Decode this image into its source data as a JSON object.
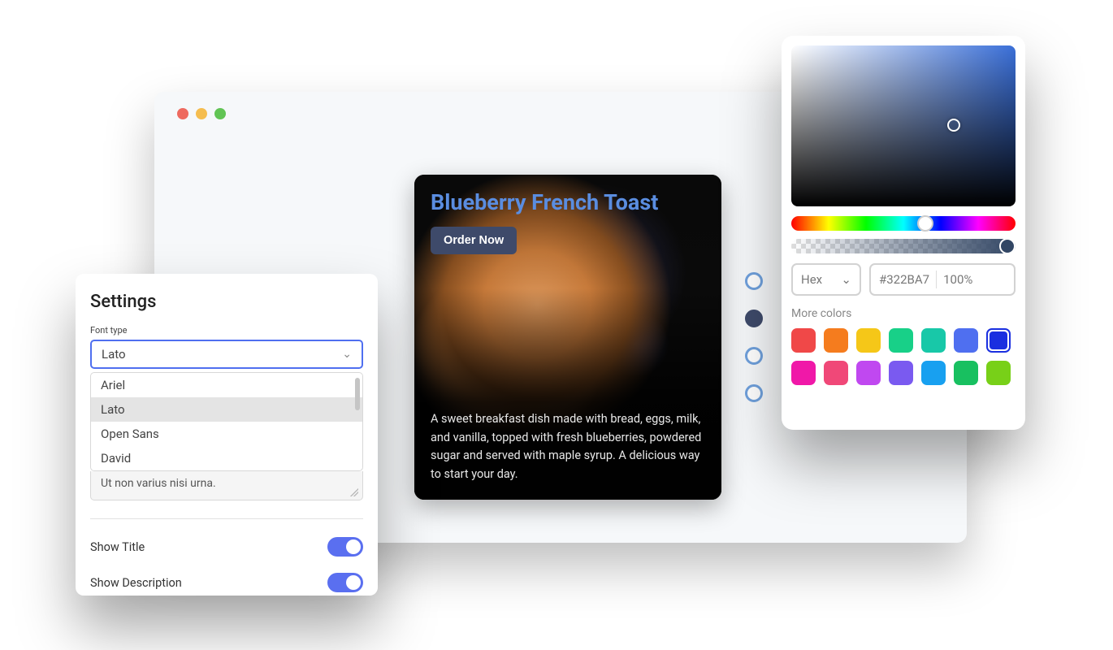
{
  "browser": {
    "traffic_lights": [
      "close",
      "minimize",
      "zoom"
    ]
  },
  "recipe": {
    "title": "Blueberry French Toast",
    "button_label": "Order Now",
    "description": "A sweet breakfast dish made with bread, eggs, milk, and vanilla, topped with fresh blueberries, powdered sugar and served with maple syrup. A delicious way to start your day."
  },
  "side_dots": {
    "count": 4,
    "active_index": 1
  },
  "settings": {
    "title": "Settings",
    "font_label": "Font type",
    "font_selected": "Lato",
    "font_options": [
      "Ariel",
      "Lato",
      "Open Sans",
      "David"
    ],
    "textarea_value": "Ut non varius nisi urna.",
    "switch_show_title": {
      "label": "Show Title",
      "value": true
    },
    "switch_show_description": {
      "label": "Show Description",
      "value": true
    }
  },
  "color_picker": {
    "format_label": "Hex",
    "hex_value": "#322BA7",
    "alpha_label": "100%",
    "more_colors_label": "More colors",
    "swatches": [
      "#f04848",
      "#f57c1e",
      "#f5c718",
      "#18d088",
      "#18c8a8",
      "#4f6ff0",
      "#1a2fe0",
      "#f018a8",
      "#f04878",
      "#c048f0",
      "#7a5af0",
      "#18a0f0",
      "#18c060",
      "#78d018"
    ],
    "selected_swatch_index": 6
  }
}
